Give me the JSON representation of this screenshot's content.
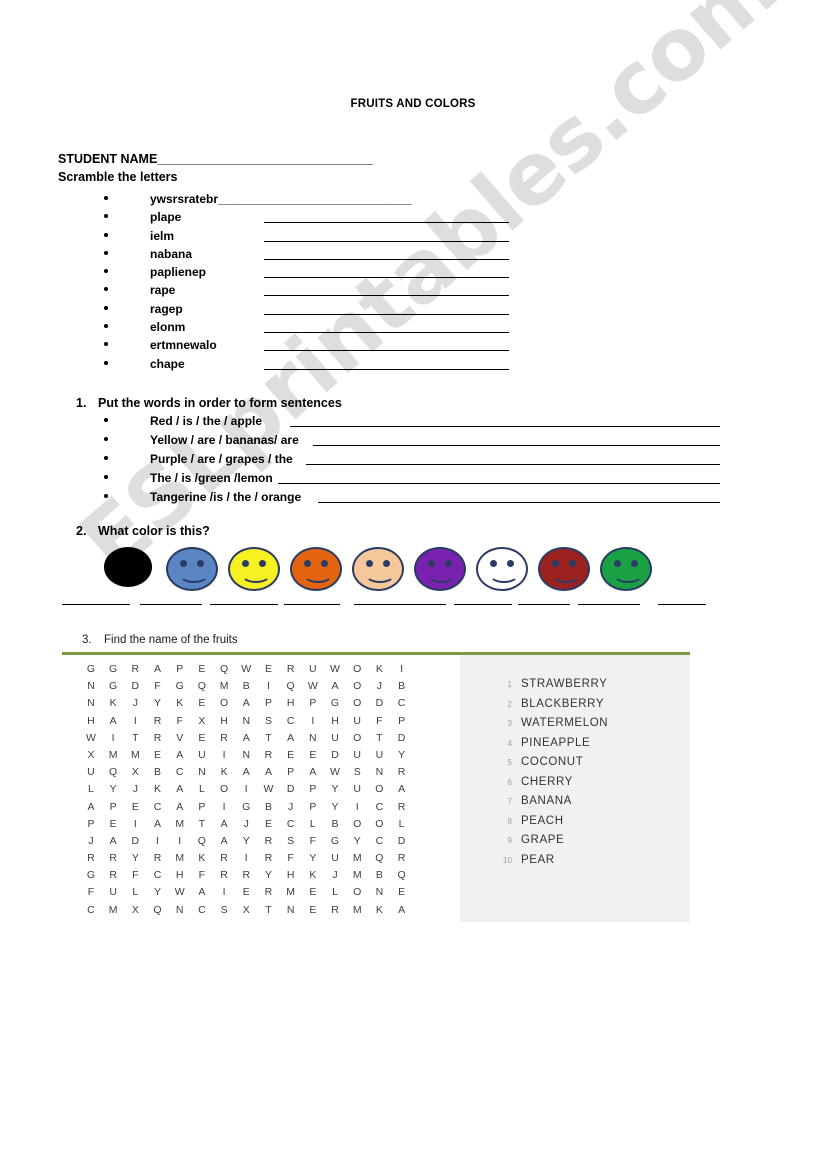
{
  "title": "FRUITS AND COLORS",
  "student_name_label": "STUDENT NAME_______________________________",
  "scramble": {
    "heading": "Scramble the letters",
    "items": [
      {
        "word": "ywsrsratebr_____________________________"
      },
      {
        "word": "plape"
      },
      {
        "word": "ielm"
      },
      {
        "word": "nabana"
      },
      {
        "word": "paplienep"
      },
      {
        "word": "rape"
      },
      {
        "word": "ragep"
      },
      {
        "word": "elonm"
      },
      {
        "word": "ertmnewalo"
      },
      {
        "word": "chape"
      }
    ]
  },
  "sentences": {
    "number": "1.",
    "heading": "Put the words in order to form sentences",
    "items": [
      {
        "text": "Red / is / the / apple"
      },
      {
        "text": "Yellow / are / bananas/ are"
      },
      {
        "text": "Purple / are / grapes / the"
      },
      {
        "text": "The / is /green /lemon"
      },
      {
        "text": "Tangerine /is / the / orange"
      }
    ]
  },
  "colors": {
    "number": "2.",
    "heading": "What color is this?",
    "faces": [
      {
        "name": "black",
        "fill": "#000000",
        "features": false
      },
      {
        "name": "blue",
        "fill": "#5a86c4",
        "features": true
      },
      {
        "name": "yellow",
        "fill": "#f7f122",
        "features": true
      },
      {
        "name": "orange",
        "fill": "#e2640e",
        "features": true
      },
      {
        "name": "peach",
        "fill": "#f6c79a",
        "features": true
      },
      {
        "name": "purple",
        "fill": "#7a22b0",
        "features": true
      },
      {
        "name": "white",
        "fill": "#ffffff",
        "features": true
      },
      {
        "name": "dark-red",
        "fill": "#9c2220",
        "features": true
      },
      {
        "name": "green",
        "fill": "#19a144",
        "features": true
      }
    ]
  },
  "wordsearch": {
    "number": "3.",
    "heading": "Find the name of the fruits",
    "rule_color": "#7a9a3f",
    "grid": [
      [
        "G",
        "G",
        "R",
        "A",
        "P",
        "E",
        "Q",
        "W",
        "E",
        "R",
        "U",
        "W",
        "O",
        "K",
        "I"
      ],
      [
        "N",
        "G",
        "D",
        "F",
        "G",
        "Q",
        "M",
        "B",
        "I",
        "Q",
        "W",
        "A",
        "O",
        "J",
        "B"
      ],
      [
        "N",
        "K",
        "J",
        "Y",
        "K",
        "E",
        "O",
        "A",
        "P",
        "H",
        "P",
        "G",
        "O",
        "D",
        "C"
      ],
      [
        "H",
        "A",
        "I",
        "R",
        "F",
        "X",
        "H",
        "N",
        "S",
        "C",
        "I",
        "H",
        "U",
        "F",
        "P"
      ],
      [
        "W",
        "I",
        "T",
        "R",
        "V",
        "E",
        "R",
        "A",
        "T",
        "A",
        "N",
        "U",
        "O",
        "T",
        "D"
      ],
      [
        "X",
        "M",
        "M",
        "E",
        "A",
        "U",
        "I",
        "N",
        "R",
        "E",
        "E",
        "D",
        "U",
        "U",
        "Y"
      ],
      [
        "U",
        "Q",
        "X",
        "B",
        "C",
        "N",
        "K",
        "A",
        "A",
        "P",
        "A",
        "W",
        "S",
        "N",
        "R"
      ],
      [
        "L",
        "Y",
        "J",
        "K",
        "A",
        "L",
        "O",
        "I",
        "W",
        "D",
        "P",
        "Y",
        "U",
        "O",
        "A"
      ],
      [
        "A",
        "P",
        "E",
        "C",
        "A",
        "P",
        "I",
        "G",
        "B",
        "J",
        "P",
        "Y",
        "I",
        "C",
        "R"
      ],
      [
        "P",
        "E",
        "I",
        "A",
        "M",
        "T",
        "A",
        "J",
        "E",
        "C",
        "L",
        "B",
        "O",
        "O",
        "L"
      ],
      [
        "J",
        "A",
        "D",
        "I",
        "I",
        "Q",
        "A",
        "Y",
        "R",
        "S",
        "F",
        "G",
        "Y",
        "C",
        "D"
      ],
      [
        "R",
        "R",
        "Y",
        "R",
        "M",
        "K",
        "R",
        "I",
        "R",
        "F",
        "Y",
        "U",
        "M",
        "Q",
        "R"
      ],
      [
        "G",
        "R",
        "F",
        "C",
        "H",
        "F",
        "R",
        "R",
        "Y",
        "H",
        "K",
        "J",
        "M",
        "B",
        "Q"
      ],
      [
        "F",
        "U",
        "L",
        "Y",
        "W",
        "A",
        "I",
        "E",
        "R",
        "M",
        "E",
        "L",
        "O",
        "N",
        "E"
      ],
      [
        "C",
        "M",
        "X",
        "Q",
        "N",
        "C",
        "S",
        "X",
        "T",
        "N",
        "E",
        "R",
        "M",
        "K",
        "A"
      ]
    ],
    "words": [
      {
        "index": "1",
        "word": "STRAWBERRY"
      },
      {
        "index": "2",
        "word": "BLACKBERRY"
      },
      {
        "index": "3",
        "word": "WATERMELON"
      },
      {
        "index": "4",
        "word": "PINEAPPLE"
      },
      {
        "index": "5",
        "word": "COCONUT"
      },
      {
        "index": "6",
        "word": "CHERRY"
      },
      {
        "index": "7",
        "word": "BANANA"
      },
      {
        "index": "8",
        "word": "PEACH"
      },
      {
        "index": "9",
        "word": "GRAPE"
      },
      {
        "index": "10",
        "word": "PEAR"
      }
    ]
  },
  "watermark": {
    "text": "ESLprintables.com"
  }
}
